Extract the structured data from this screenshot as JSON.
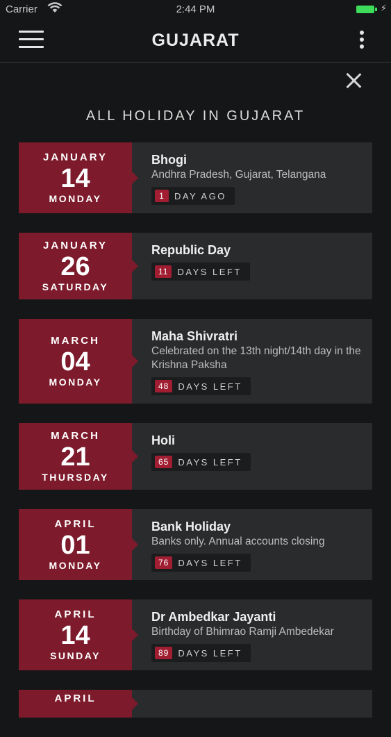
{
  "status_bar": {
    "carrier": "Carrier",
    "time": "2:44 PM"
  },
  "header": {
    "title": "GUJARAT"
  },
  "section_title": "ALL HOLIDAY IN GUJARAT",
  "colors": {
    "accent": "#7d1b2c",
    "badge": "#a11e32",
    "background": "#151617",
    "card": "#2a2b2d"
  },
  "holidays": [
    {
      "month": "JANUARY",
      "day": "14",
      "weekday": "MONDAY",
      "name": "Bhogi",
      "description": "Andhra Pradesh, Gujarat, Telangana",
      "count": "1",
      "label": "DAY AGO"
    },
    {
      "month": "JANUARY",
      "day": "26",
      "weekday": "SATURDAY",
      "name": "Republic Day",
      "description": "",
      "count": "11",
      "label": "DAYS LEFT"
    },
    {
      "month": "MARCH",
      "day": "04",
      "weekday": "MONDAY",
      "name": "Maha Shivratri",
      "description": "Celebrated on the 13th night/14th day in the Krishna Paksha",
      "count": "48",
      "label": "DAYS LEFT"
    },
    {
      "month": "MARCH",
      "day": "21",
      "weekday": "THURSDAY",
      "name": "Holi",
      "description": "",
      "count": "65",
      "label": "DAYS LEFT"
    },
    {
      "month": "APRIL",
      "day": "01",
      "weekday": "MONDAY",
      "name": "Bank Holiday",
      "description": "Banks only. Annual accounts closing",
      "count": "76",
      "label": "DAYS LEFT"
    },
    {
      "month": "APRIL",
      "day": "14",
      "weekday": "SUNDAY",
      "name": "Dr Ambedkar Jayanti",
      "description": "Birthday of Bhimrao Ramji Ambedekar",
      "count": "89",
      "label": "DAYS LEFT"
    },
    {
      "month": "APRIL",
      "day": "",
      "weekday": "",
      "name": "",
      "description": "",
      "count": "",
      "label": ""
    }
  ]
}
